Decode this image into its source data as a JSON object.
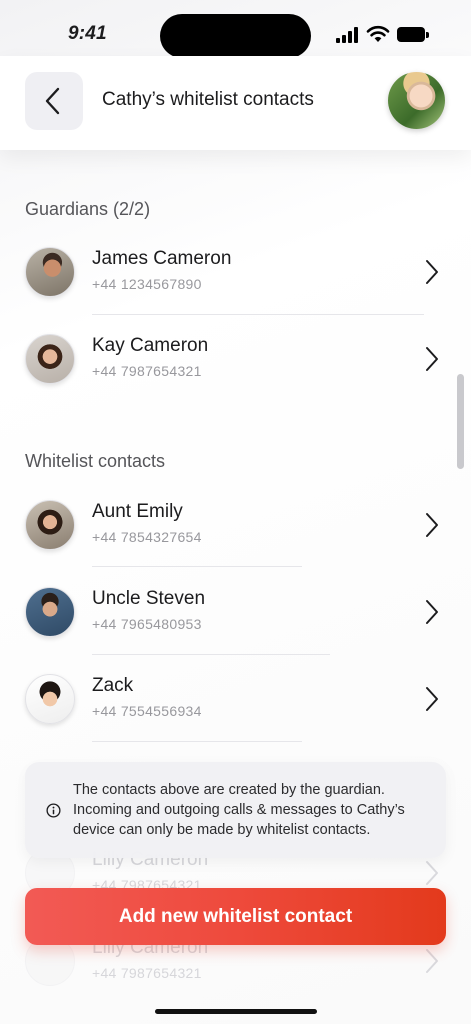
{
  "status_bar": {
    "time": "9:41"
  },
  "header": {
    "title": "Cathy’s whitelist contacts"
  },
  "guardians": {
    "title": "Guardians (2/2)",
    "items": [
      {
        "name": "James Cameron",
        "phone": "+44 1234567890"
      },
      {
        "name": "Kay Cameron",
        "phone": "+44 7987654321"
      }
    ]
  },
  "whitelist": {
    "title": "Whitelist contacts",
    "items": [
      {
        "name": "Aunt Emily",
        "phone": "+44 7854327654"
      },
      {
        "name": "Uncle Steven",
        "phone": "+44 7965480953"
      },
      {
        "name": "Zack",
        "phone": "+44 7554556934"
      }
    ],
    "hidden_items": [
      {
        "name": "Lilly Cameron",
        "phone": "+44 7987654321"
      },
      {
        "name": "Lilly Cameron",
        "phone": "+44 7987654321"
      }
    ]
  },
  "info": {
    "text": "The contacts above are created by the guardian. Incoming and outgoing calls & messages to Cathy’s device can only be made by whitelist contacts."
  },
  "actions": {
    "add_button": "Add new whitelist contact"
  },
  "colors": {
    "accent_start": "#f25a55",
    "accent_end": "#e33a1c"
  },
  "icons": {
    "back": "chevron-left-icon",
    "row": "chevron-right-icon",
    "info": "info-circle-icon"
  }
}
